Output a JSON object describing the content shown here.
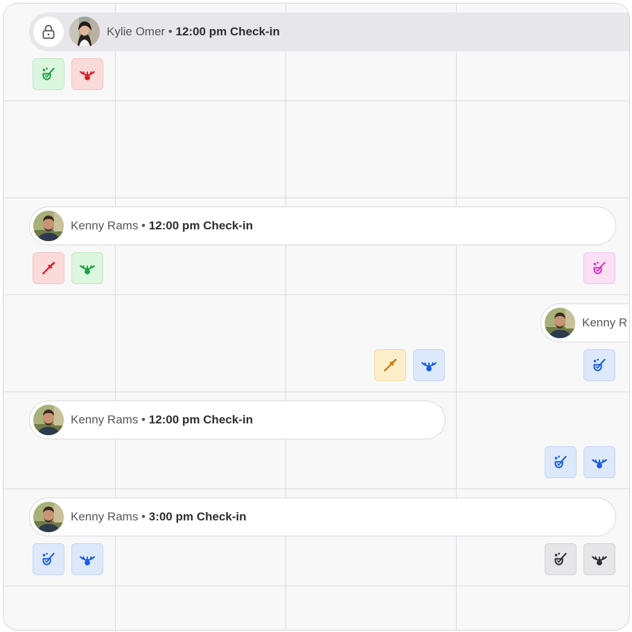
{
  "rows": [
    {
      "id": "row1",
      "name": "Kylie Omer",
      "separator": " • ",
      "time": "12:00 pm Check-in",
      "locked": true
    },
    {
      "id": "row2",
      "name": "Kenny Rams",
      "separator": " • ",
      "time": "12:00 pm Check-in",
      "locked": false
    },
    {
      "id": "row3",
      "name": "Kenny R",
      "locked": false,
      "truncated": true
    },
    {
      "id": "row4",
      "name": "Kenny Rams",
      "separator": " • ",
      "time": "12:00 pm Check-in",
      "locked": false
    },
    {
      "id": "row5",
      "name": "Kenny Rams",
      "separator": " • ",
      "time": "3:00 pm Check-in",
      "locked": false
    }
  ],
  "badge_colors": {
    "green": "#1e9e46",
    "red": "#d8202a",
    "pink": "#d631b9",
    "yellow": "#c9780e",
    "blue": "#1a5fe0",
    "gray": "#2f2f33"
  },
  "badges": [
    {
      "row": 1,
      "icon": "cleaning-icon",
      "color": "green"
    },
    {
      "row": 1,
      "icon": "eye-icon",
      "color": "red"
    },
    {
      "row": 2,
      "icon": "dropper-icon",
      "color": "red"
    },
    {
      "row": 2,
      "icon": "eye-icon",
      "color": "green"
    },
    {
      "row": 2,
      "icon": "cleaning-icon",
      "color": "pink"
    },
    {
      "row": 3,
      "icon": "dropper-icon",
      "color": "yellow"
    },
    {
      "row": 3,
      "icon": "eye-icon",
      "color": "blue"
    },
    {
      "row": 3,
      "icon": "cleaning-icon",
      "color": "blue"
    },
    {
      "row": 4,
      "icon": "cleaning-icon",
      "color": "blue"
    },
    {
      "row": 4,
      "icon": "eye-icon",
      "color": "blue"
    },
    {
      "row": 5,
      "icon": "cleaning-icon",
      "color": "blue"
    },
    {
      "row": 5,
      "icon": "eye-icon",
      "color": "blue"
    },
    {
      "row": 5,
      "icon": "cleaning-icon",
      "color": "gray"
    },
    {
      "row": 5,
      "icon": "eye-icon",
      "color": "gray"
    }
  ]
}
